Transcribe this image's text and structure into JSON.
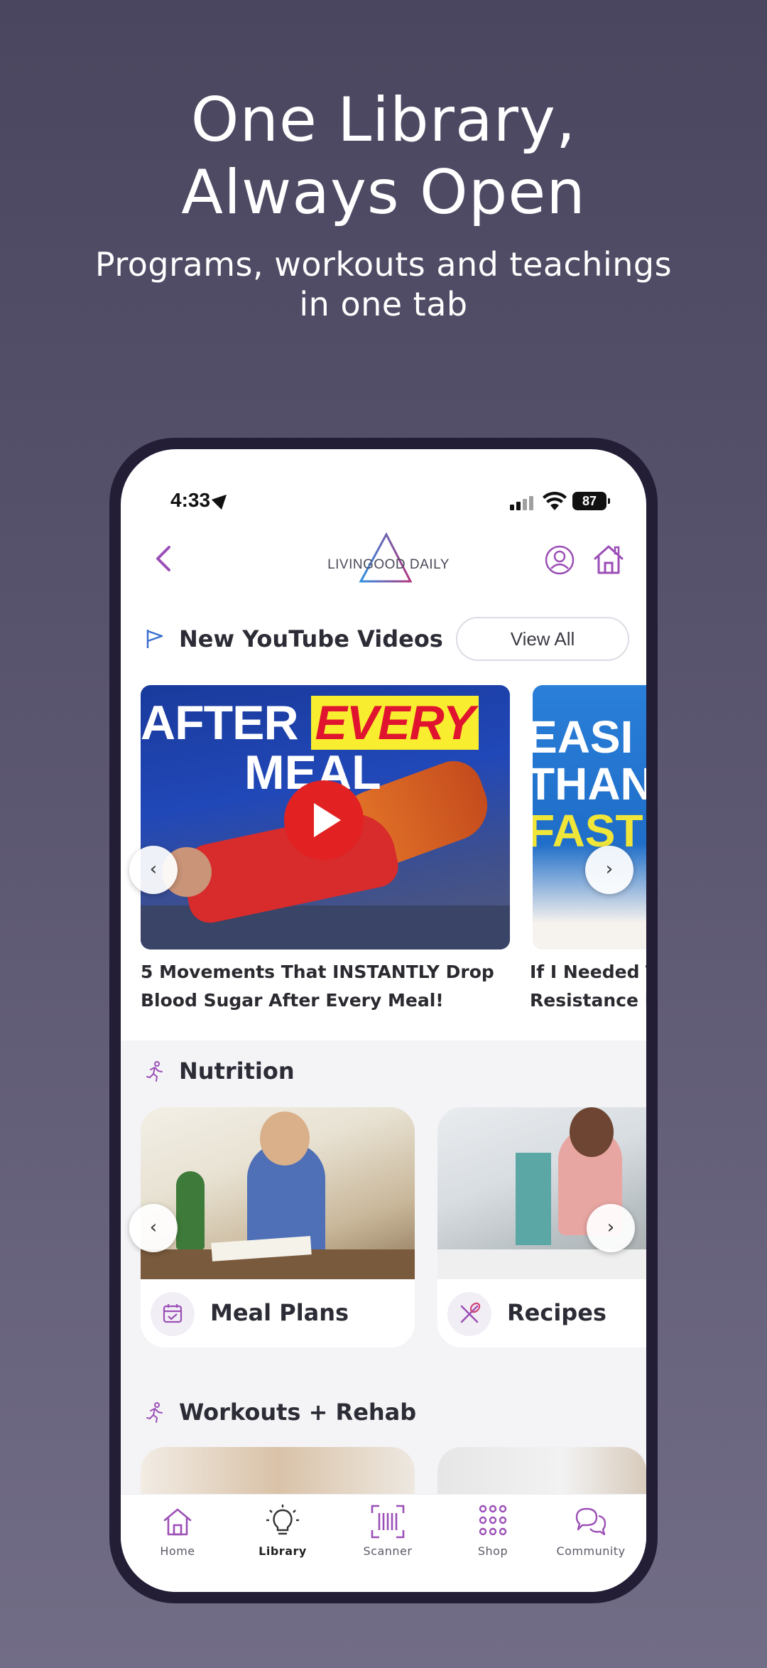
{
  "promo": {
    "headline_line1": "One Library,",
    "headline_line2": "Always Open",
    "sub_line1": "Programs, workouts and teachings",
    "sub_line2": "in one tab"
  },
  "status_bar": {
    "time": "4:33",
    "battery": "87"
  },
  "header": {
    "logo_text": "LIVINGOOD DAILY",
    "accent_color": "#9b4fb6"
  },
  "youtube": {
    "title": "New YouTube Videos",
    "view_all": "View All",
    "videos": [
      {
        "thumb_word1": "AFTER",
        "thumb_word2": "EVERY",
        "thumb_word3": "MEAL",
        "title_line1": "5 Movements That INSTANTLY Drop",
        "title_line2": "Blood Sugar After Every Meal!"
      },
      {
        "thumb_line1": "EASI",
        "thumb_line2": "THAN",
        "thumb_line3": "FAST",
        "title_line1": "If I Needed T",
        "title_line2": "Resistance F"
      }
    ],
    "prev_arrow": "‹",
    "next_arrow": "›"
  },
  "nutrition": {
    "title": "Nutrition",
    "cards": [
      {
        "label": "Meal Plans",
        "icon": "calendar-icon"
      },
      {
        "label": "Recipes",
        "icon": "utensils-icon"
      }
    ],
    "prev_arrow": "‹",
    "next_arrow": "›"
  },
  "workouts": {
    "title": "Workouts + Rehab"
  },
  "tabbar": {
    "items": [
      {
        "label": "Home",
        "icon": "home-icon"
      },
      {
        "label": "Library",
        "icon": "lightbulb-icon",
        "active": true
      },
      {
        "label": "Scanner",
        "icon": "barcode-icon"
      },
      {
        "label": "Shop",
        "icon": "grid-icon"
      },
      {
        "label": "Community",
        "icon": "chat-icon"
      }
    ]
  }
}
